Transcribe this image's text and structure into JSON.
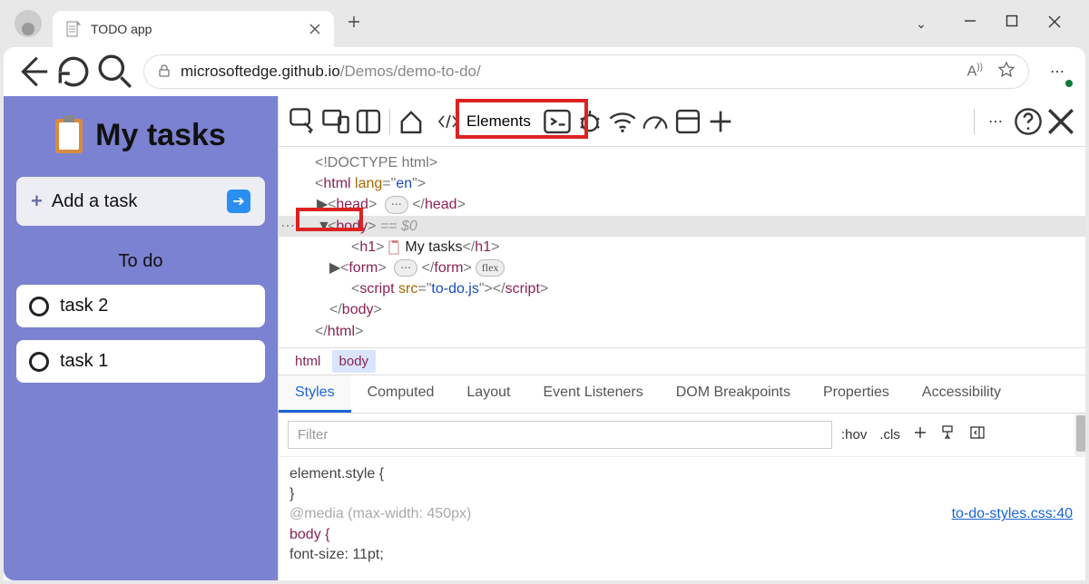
{
  "browser": {
    "tab_title": "TODO app",
    "url_prefix": "microsoftedge.github.io",
    "url_suffix": "/Demos/demo-to-do/"
  },
  "app": {
    "title": "My tasks",
    "add_placeholder": "Add a task",
    "section": "To do",
    "tasks": [
      "task 2",
      "task 1"
    ]
  },
  "devtools": {
    "elements_label": "Elements",
    "dom": {
      "doctype": "<!DOCTYPE html>",
      "lang": "en",
      "h1_text": " My tasks",
      "script_src": "to-do.js",
      "flex_badge": "flex",
      "eq0": " == $0"
    },
    "breadcrumbs": [
      "html",
      "body"
    ],
    "styles_tabs": [
      "Styles",
      "Computed",
      "Layout",
      "Event Listeners",
      "DOM Breakpoints",
      "Properties",
      "Accessibility"
    ],
    "filter_placeholder": "Filter",
    "filter_tools": [
      ":hov",
      ".cls"
    ],
    "css": {
      "line1": "element.style {",
      "line2": "}",
      "media": "@media (max-width: 450px)",
      "selector": "body {",
      "rule": "  font-size: 11pt;",
      "link": "to-do-styles.css:40"
    }
  }
}
